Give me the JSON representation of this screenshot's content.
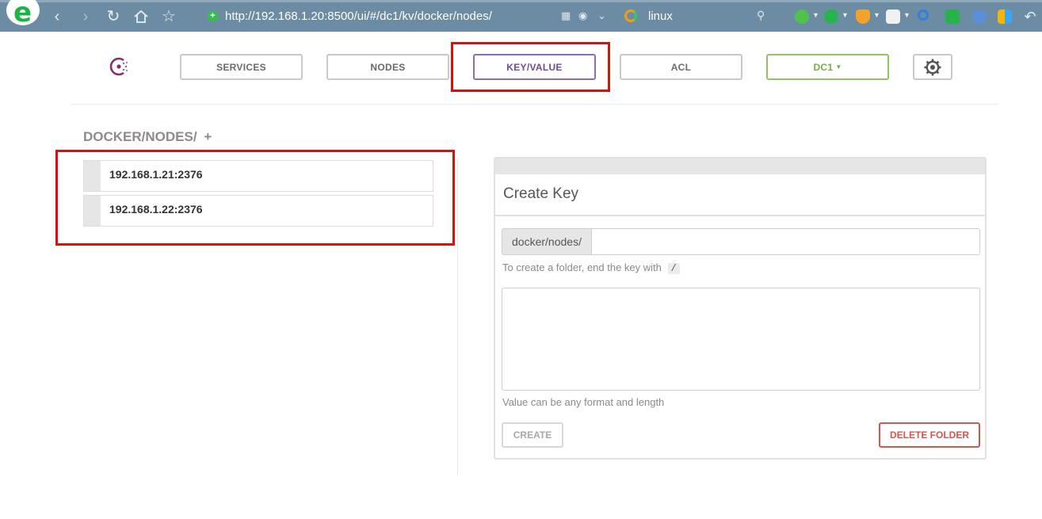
{
  "browser": {
    "url": "http://192.168.1.20:8500/ui/#/dc1/kv/docker/nodes/",
    "search_text": "linux"
  },
  "nav": {
    "services": "SERVICES",
    "nodes": "NODES",
    "key_value": "KEY/VALUE",
    "acl": "ACL",
    "datacenter": "DC1"
  },
  "kv": {
    "breadcrumb": "DOCKER/NODES/",
    "add_symbol": "+",
    "keys": [
      "192.168.1.21:2376",
      "192.168.1.22:2376"
    ]
  },
  "create": {
    "title": "Create Key",
    "key_prefix": "docker/nodes/",
    "key_value": "",
    "folder_hint": "To create a folder, end the key with",
    "folder_char": "/",
    "value_hint": "Value can be any format and length",
    "create_label": "CREATE",
    "delete_label": "DELETE FOLDER"
  },
  "colors": {
    "accent": "#6e4a9e",
    "dc_green": "#77ae45",
    "danger": "#d9534f",
    "highlight": "#e10d0d"
  }
}
